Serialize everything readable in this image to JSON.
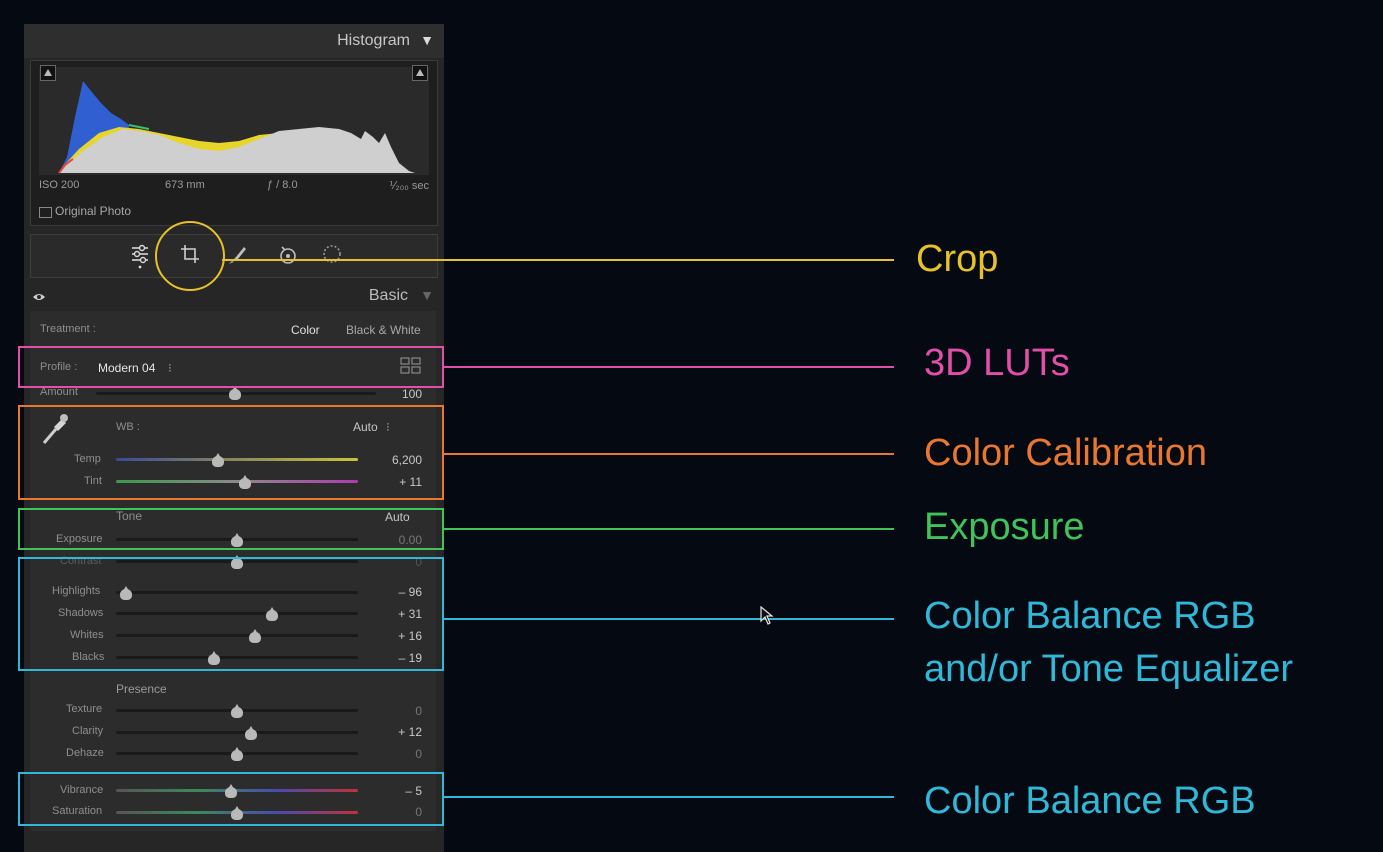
{
  "colors": {
    "crop": "#e8c12a",
    "luts": "#e24fa8",
    "calibration": "#e9782e",
    "exposure": "#3fc35a",
    "balance": "#2fb8d8"
  },
  "histogram": {
    "title": "Histogram",
    "iso": "ISO 200",
    "focal": "673 mm",
    "aperture": "ƒ / 8.0",
    "shutter": "⅟₂₀₀ sec",
    "original_photo": "Original Photo"
  },
  "tools": [
    "sliders-icon",
    "crop-icon",
    "brush-icon",
    "heal-icon",
    "radial-icon"
  ],
  "basic": {
    "title": "Basic",
    "treatment_label": "Treatment :",
    "treatment_color": "Color",
    "treatment_bw": "Black & White",
    "profile_label": "Profile :",
    "profile_value": "Modern 04",
    "profile_chevron": "⁝",
    "amount_label": "Amount",
    "amount_value": "100",
    "wb_label": "WB :",
    "wb_value": "Auto",
    "wb_chevron": "⁝",
    "temp_label": "Temp",
    "temp_value": "6,200",
    "tint_label": "Tint",
    "tint_value": "+ 11",
    "tone_label": "Tone",
    "tone_auto": "Auto",
    "exposure_label": "Exposure",
    "exposure_value": "0.00",
    "contrast_label": "Contrast",
    "contrast_value": "0",
    "highlights_label": "Highlights",
    "highlights_value": "– 96",
    "shadows_label": "Shadows",
    "shadows_value": "+ 31",
    "whites_label": "Whites",
    "whites_value": "+ 16",
    "blacks_label": "Blacks",
    "blacks_value": "– 19",
    "presence_label": "Presence",
    "texture_label": "Texture",
    "texture_value": "0",
    "clarity_label": "Clarity",
    "clarity_value": "+ 12",
    "dehaze_label": "Dehaze",
    "dehaze_value": "0",
    "vibrance_label": "Vibrance",
    "vibrance_value": "– 5",
    "saturation_label": "Saturation",
    "saturation_value": "0"
  },
  "annotations": {
    "crop": "Crop",
    "luts": "3D LUTs",
    "calibration": "Color Calibration",
    "exposure": "Exposure",
    "balance_tone_1": "Color Balance RGB",
    "balance_tone_2": "and/or Tone Equalizer",
    "balance": "Color Balance RGB"
  }
}
